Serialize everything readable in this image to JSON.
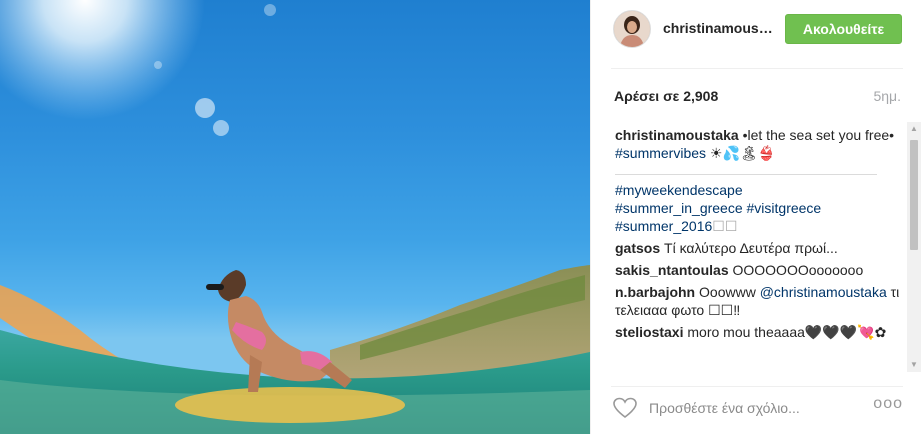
{
  "post": {
    "username": "christinamoustaka",
    "follow_label": "Ακολουθείτε",
    "likes": "Αρέσει σε 2,908",
    "time": "5ημ."
  },
  "caption": {
    "user": "christinamoustaka",
    "text": " •let the sea set you free• ",
    "hashtag": "#summervibes",
    "emoji": " ☀💦🏝👙"
  },
  "hashtags": {
    "line1": "#myweekendescape",
    "line2a": "#summer_in_greece",
    "line2b": " #visitgreece",
    "line3": "#summer_2016",
    "line3_suffix": "☐☐"
  },
  "comments": [
    {
      "user": "gatsos",
      "text": " Τί καλύτερο Δευτέρα πρωί..."
    },
    {
      "user": "sakis_ntantoulas",
      "text": " ΟΟΟΟΟΟΟooooooo"
    },
    {
      "user": "n.barbajohn",
      "text": " Ooowww ",
      "mention": "@christinamoustaka",
      "after": " τι τελειααα φωτο ☐☐‼"
    },
    {
      "user": "steliostaxi",
      "text": " moro mou theaaaa🖤🖤🖤💘✿"
    }
  ],
  "comment_box": {
    "placeholder": "Προσθέστε ένα σχόλιο..."
  },
  "more_label": "ooo"
}
